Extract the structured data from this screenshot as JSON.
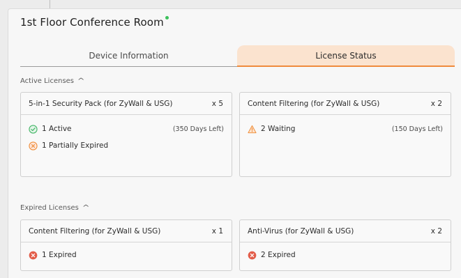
{
  "header": {
    "title": "1st Floor Conference Room"
  },
  "tabs": [
    {
      "label": "Device Information",
      "active": false
    },
    {
      "label": "License Status",
      "active": true
    }
  ],
  "active_section": {
    "label": "Active Licenses"
  },
  "expired_section": {
    "label": "Expired Licenses"
  },
  "active_cards": [
    {
      "name": "5-in-1 Security Pack (for ZyWall & USG)",
      "qty": "x 5",
      "rows": [
        {
          "icon": "check-circle-icon",
          "status": "1 Active",
          "days": "(350 Days Left)"
        },
        {
          "icon": "x-circle-outline-icon",
          "status": "1 Partially Expired",
          "days": ""
        }
      ]
    },
    {
      "name": "Content Filtering (for ZyWall & USG)",
      "qty": "x 2",
      "rows": [
        {
          "icon": "warning-triangle-icon",
          "status": "2 Waiting",
          "days": "(150 Days Left)"
        }
      ]
    }
  ],
  "expired_cards": [
    {
      "name": "Content Filtering (for ZyWall & USG)",
      "qty": "x 1",
      "rows": [
        {
          "icon": "x-circle-filled-icon",
          "status": "1 Expired",
          "days": ""
        }
      ]
    },
    {
      "name": "Anti-Virus (for ZyWall & USG)",
      "qty": "x 2",
      "rows": [
        {
          "icon": "x-circle-filled-icon",
          "status": "2 Expired",
          "days": ""
        }
      ]
    }
  ],
  "colors": {
    "accent": "#f08a3c",
    "tab_active_bg": "#fbe3cf",
    "ok": "#47b86a",
    "warn": "#f0913f",
    "error": "#e35d4a",
    "online": "#3cc15c"
  }
}
